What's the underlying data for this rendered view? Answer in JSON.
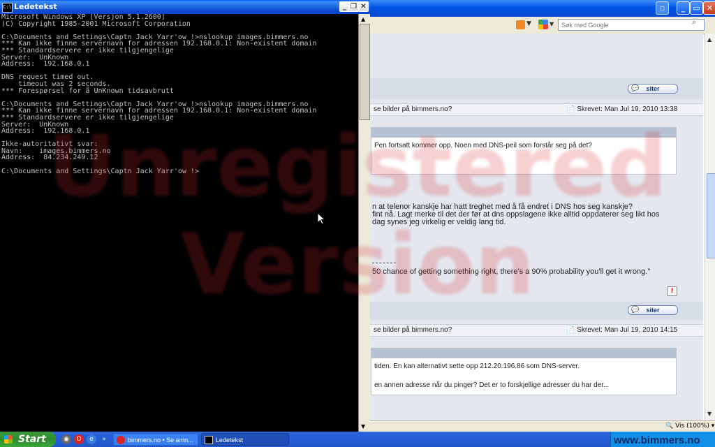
{
  "browser": {
    "search_placeholder": "Søk med Google",
    "zoom": "Vis (100%)",
    "quote_button_label": "siter",
    "posts": [
      {
        "subject": "se bilder på bimmers.no?",
        "date": "Skrevet: Man Jul 19, 2010 13:38",
        "quote_text": "Pen fortsatt kommer opp. Noen med DNS-peil som forstår seg på det?",
        "body_lines": [
          "n at telenor kanskje har hatt treghet med å få endret i DNS hos seg kanskje?",
          "fint nå. Lagt merke til det der før at dns oppslagene ikke alltid oppdaterer seg likt hos",
          "dag synes jeg virkelig er veldig lang tid."
        ],
        "signature": "50 chance of getting something right, there's a 90% probability you'll get it wrong.\""
      },
      {
        "subject": "se bilder på bimmers.no?",
        "date": "Skrevet: Man Jul 19, 2010 14:15",
        "quote_text": "tiden. En kan alternativt sette opp 212.20.196.86 som DNS-server.",
        "body_line": "en annen adresse når du pinger? Det er to forskjellige adresser du har der..."
      }
    ]
  },
  "console": {
    "title": "Ledetekst",
    "lines": [
      "Microsoft Windows XP [Versjon 5.1.2600]",
      "(C) Copyright 1985-2001 Microsoft Corporation",
      "",
      "C:\\Documents and Settings\\Captn Jack Yarr'ow !>nslookup images.bimmers.no",
      "*** Kan ikke finne servernavn for adressen 192.168.0.1: Non-existent domain",
      "*** Standardservere er ikke tilgjengelige",
      "Server:  UnKnown",
      "Address:  192.168.0.1",
      "",
      "DNS request timed out.",
      "    timeout was 2 seconds.",
      "*** Forespørsel for å UnKnown tidsavbrutt",
      "",
      "C:\\Documents and Settings\\Captn Jack Yarr'ow !>nslookup images.bimmers.no",
      "*** Kan ikke finne servernavn for adressen 192.168.0.1: Non-existent domain",
      "*** Standardservere er ikke tilgjengelige",
      "Server:  UnKnown",
      "Address:  192.168.0.1",
      "",
      "Ikke-autoritativt svar:",
      "Navn:    images.bimmers.no",
      "Address:  84.234.249.12",
      "",
      "C:\\Documents and Settings\\Captn Jack Yarr'ow !>"
    ]
  },
  "watermark": {
    "line1": "Unregistered",
    "line2": "Version"
  },
  "taskbar": {
    "start_label": "Start",
    "tasks": [
      {
        "label": "bimmers.no • Se amn..."
      },
      {
        "label": "Ledetekst"
      }
    ],
    "tray_site": "www.bimmers.no"
  }
}
